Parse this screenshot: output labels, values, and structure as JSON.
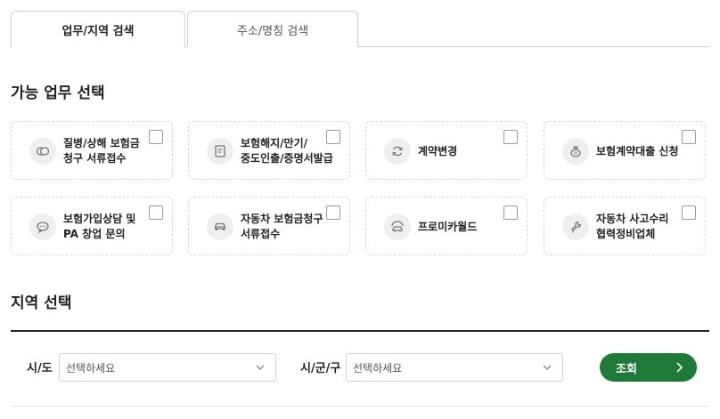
{
  "tabs": [
    {
      "label": "업무/지역 검색",
      "active": true
    },
    {
      "label": "주소/명칭 검색",
      "active": false
    }
  ],
  "task_section": {
    "title": "가능 업무 선택"
  },
  "tasks": [
    {
      "label": "질병/상해 보험금\n청구 서류접수",
      "icon": "coins-icon",
      "checked": false
    },
    {
      "label": "보험해지/만기/\n중도인출/증명서발급",
      "icon": "document-icon",
      "checked": false
    },
    {
      "label": "계약변경",
      "icon": "refresh-icon",
      "checked": false
    },
    {
      "label": "보험계약대출 신청",
      "icon": "money-bag-icon",
      "checked": false
    },
    {
      "label": "보험가입상담 및\nPA 창업 문의",
      "icon": "chat-icon",
      "checked": false
    },
    {
      "label": "자동차 보험금청구\n서류접수",
      "icon": "car-icon",
      "checked": false
    },
    {
      "label": "프로미카월드",
      "icon": "car-service-icon",
      "checked": false
    },
    {
      "label": "자동차 사고수리\n협력정비업체",
      "icon": "wrench-icon",
      "checked": false
    }
  ],
  "region_section": {
    "title": "지역 선택"
  },
  "region": {
    "sido_label": "시/도",
    "sido_value": "선택하세요",
    "sigungu_label": "시/군/구",
    "sigungu_value": "선택하세요",
    "search_label": "조회"
  },
  "colors": {
    "accent": "#1f7a3a"
  }
}
